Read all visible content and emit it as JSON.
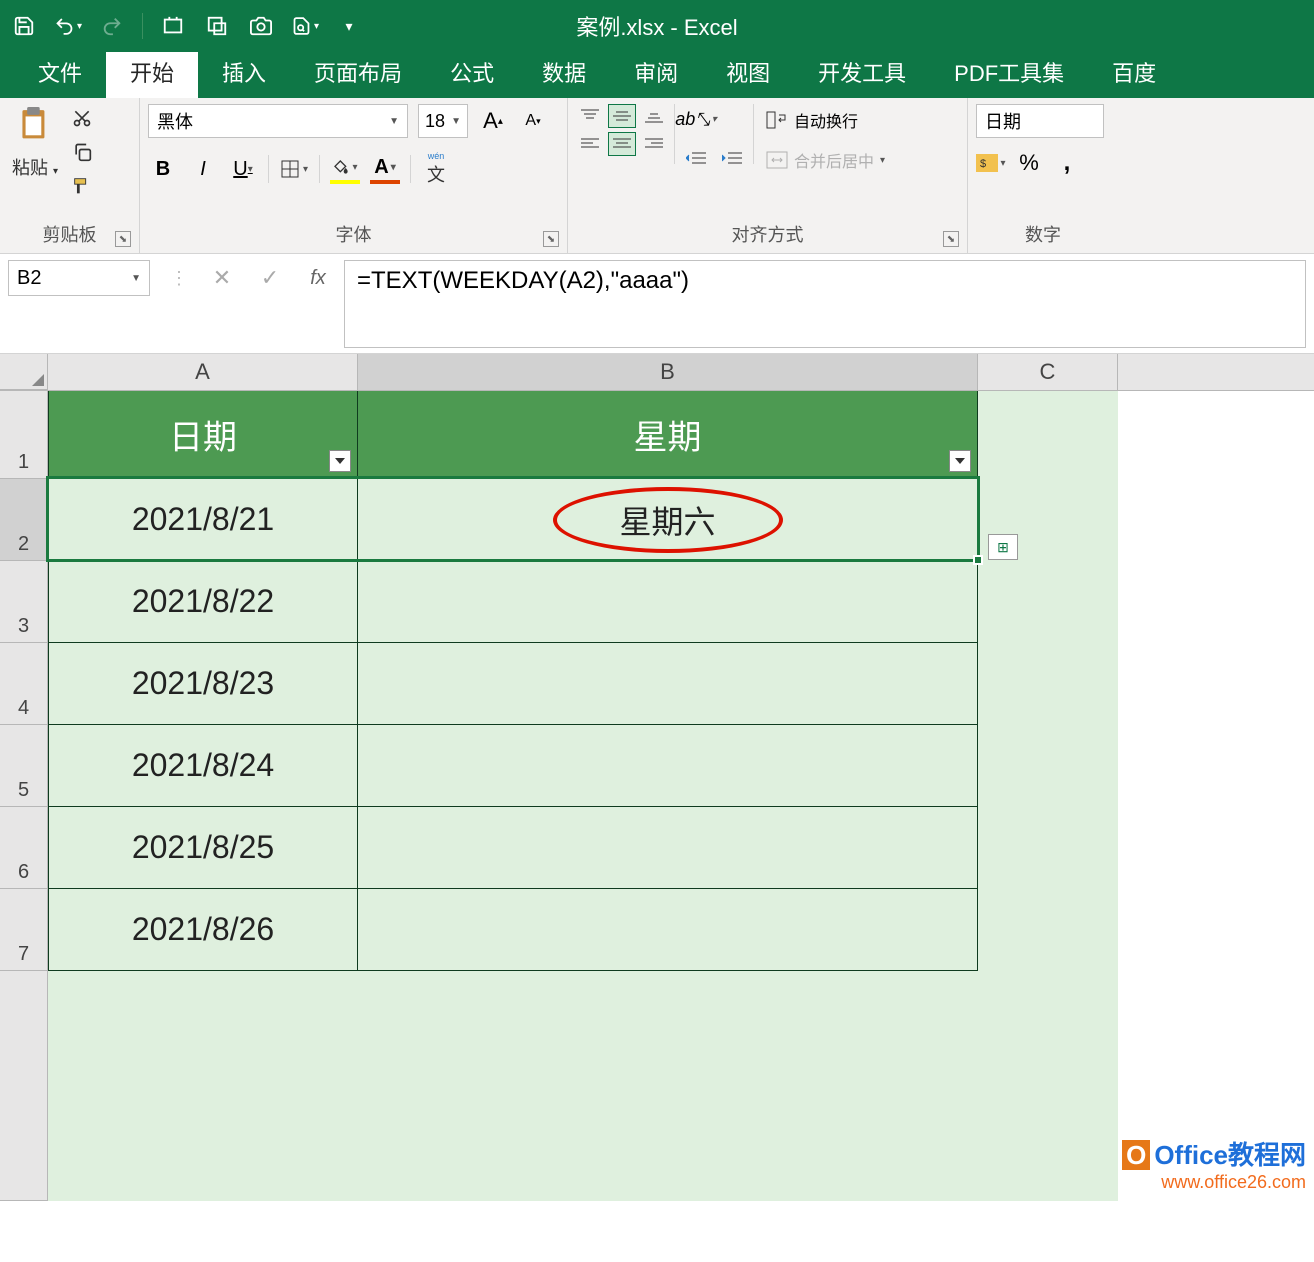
{
  "title": "案例.xlsx - Excel",
  "qat_icons": [
    "save-icon",
    "undo-icon",
    "redo-icon",
    "sep",
    "screenshot-icon",
    "new-window-icon",
    "camera-icon",
    "preview-icon",
    "more-icon"
  ],
  "tabs": {
    "items": [
      {
        "label": "文件"
      },
      {
        "label": "开始",
        "active": true
      },
      {
        "label": "插入"
      },
      {
        "label": "页面布局"
      },
      {
        "label": "公式"
      },
      {
        "label": "数据"
      },
      {
        "label": "审阅"
      },
      {
        "label": "视图"
      },
      {
        "label": "开发工具"
      },
      {
        "label": "PDF工具集"
      },
      {
        "label": "百度"
      }
    ]
  },
  "ribbon": {
    "clipboard": {
      "label": "剪贴板",
      "paste": "粘贴"
    },
    "font": {
      "label": "字体",
      "name": "黑体",
      "size": "18"
    },
    "align": {
      "label": "对齐方式",
      "wrap": "自动换行",
      "merge": "合并后居中"
    },
    "number": {
      "label": "数字",
      "format": "日期",
      "percent": "%"
    }
  },
  "formula_bar": {
    "cell": "B2",
    "formula": "=TEXT(WEEKDAY(A2),\"aaaa\")"
  },
  "columns": [
    "A",
    "B",
    "C"
  ],
  "header_row": {
    "a": "日期",
    "b": "星期"
  },
  "rows": [
    {
      "n": "2",
      "a": "2021/8/21",
      "b": "星期六"
    },
    {
      "n": "3",
      "a": "2021/8/22",
      "b": ""
    },
    {
      "n": "4",
      "a": "2021/8/23",
      "b": ""
    },
    {
      "n": "5",
      "a": "2021/8/24",
      "b": ""
    },
    {
      "n": "6",
      "a": "2021/8/25",
      "b": ""
    },
    {
      "n": "7",
      "a": "2021/8/26",
      "b": ""
    }
  ],
  "watermark": {
    "title": "Office教程网",
    "url": "www.office26.com"
  }
}
